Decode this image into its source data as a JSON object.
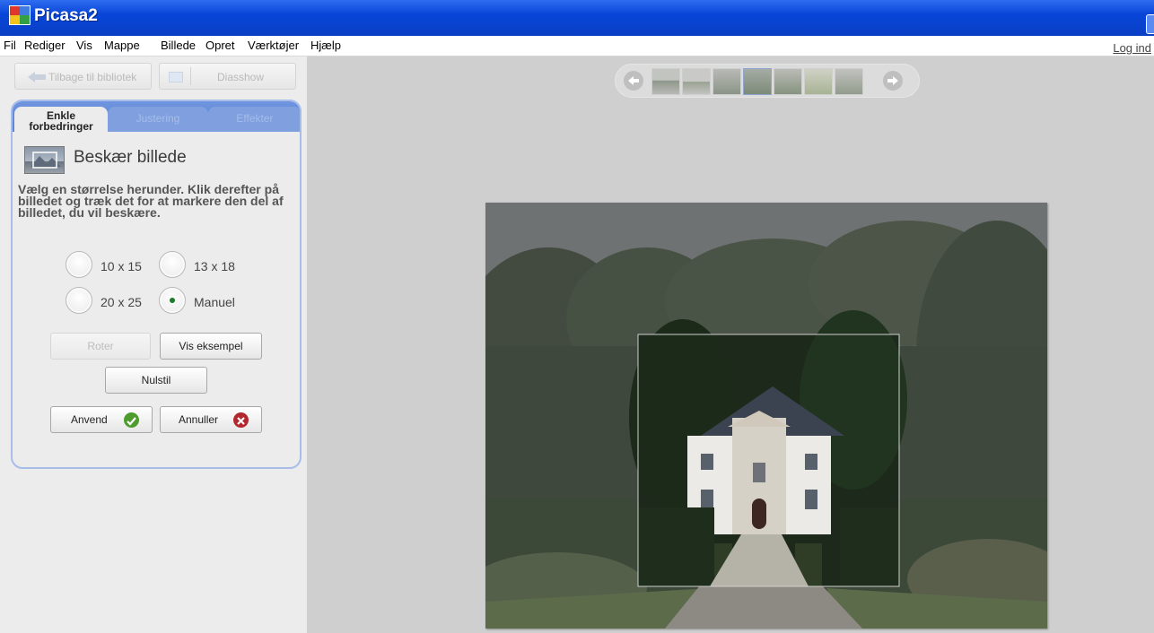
{
  "window": {
    "title": "Picasa2"
  },
  "menu": {
    "items": [
      "Fil",
      "Rediger",
      "Vis",
      "Mappe",
      "Billede",
      "Opret",
      "Værktøjer",
      "Hjælp"
    ],
    "login": "Log ind"
  },
  "toolbar": {
    "back_label": "Tilbage til bibliotek",
    "slideshow_label": "Diasshow"
  },
  "tabs": {
    "basic": [
      "Enkle",
      "forbedringer"
    ],
    "tuning": "Justering",
    "effects": "Effekter"
  },
  "crop": {
    "title": "Beskær billede",
    "instructions": "Vælg en størrelse herunder. Klik derefter på billedet og træk det for at markere den del af billedet, du vil beskære.",
    "sizes": [
      {
        "label": "10 x 15",
        "selected": false
      },
      {
        "label": "13 x 18",
        "selected": false
      },
      {
        "label": "20 x 25",
        "selected": false
      },
      {
        "label": "Manuel",
        "selected": true
      }
    ],
    "buttons": {
      "rotate": "Roter",
      "preview": "Vis eksempel",
      "reset": "Nulstil",
      "apply": "Anvend",
      "cancel": "Annuller"
    }
  },
  "colors": {
    "title_bar": "#0845d8",
    "tab_strip": "#5b83d4",
    "panel_border": "#a9bde9",
    "apply_icon": "#4f9c2e",
    "cancel_icon": "#b3272f"
  }
}
